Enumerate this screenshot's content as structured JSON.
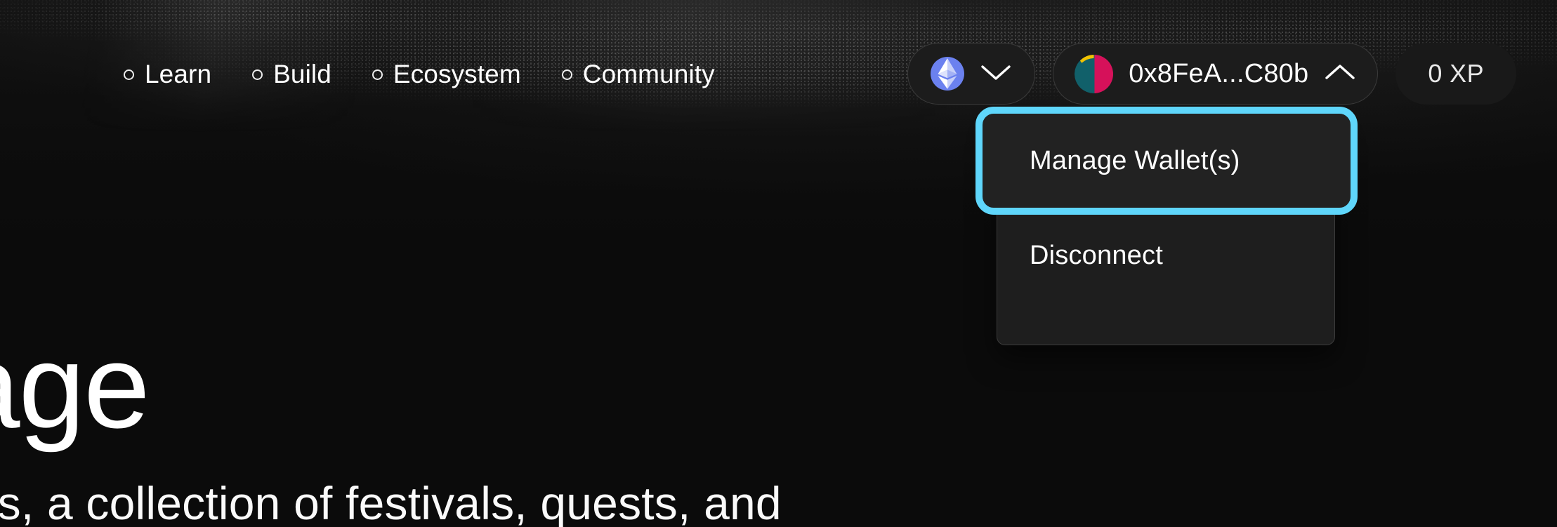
{
  "theme": {
    "background": "#0b0b0b",
    "surface": "#1c1c1c",
    "menu_surface": "#1e1e1e",
    "border": "#3a3a3a",
    "text": "#ffffff",
    "focus_ring": "#5fd6fb",
    "eth_badge": "#6b81ef",
    "avatar_teal": "#11606a",
    "avatar_crimson": "#d6115a",
    "avatar_yellow": "#f2c200"
  },
  "nav": {
    "items": [
      {
        "label": "Learn",
        "marker": "ring-icon"
      },
      {
        "label": "Build",
        "marker": "ring-icon"
      },
      {
        "label": "Ecosystem",
        "marker": "ring-icon"
      },
      {
        "label": "Community",
        "marker": "ring-icon"
      }
    ]
  },
  "actions": {
    "network": {
      "icon": "ethereum-icon",
      "chevron": "chevron-down-icon"
    },
    "wallet": {
      "avatar": "wallet-avatar-icon",
      "address": "0x8FeA...C80b",
      "chevron": "chevron-up-icon",
      "expanded": true
    },
    "xp": {
      "label": "0 XP"
    }
  },
  "wallet_menu": {
    "items": [
      {
        "label": "Manage Wallet(s)",
        "focused": true
      },
      {
        "label": "Disconnect",
        "focused": false
      }
    ]
  },
  "hero": {
    "title_fragment": "age",
    "subtitle_fragment": "ions, a collection of festivals, quests, and"
  }
}
